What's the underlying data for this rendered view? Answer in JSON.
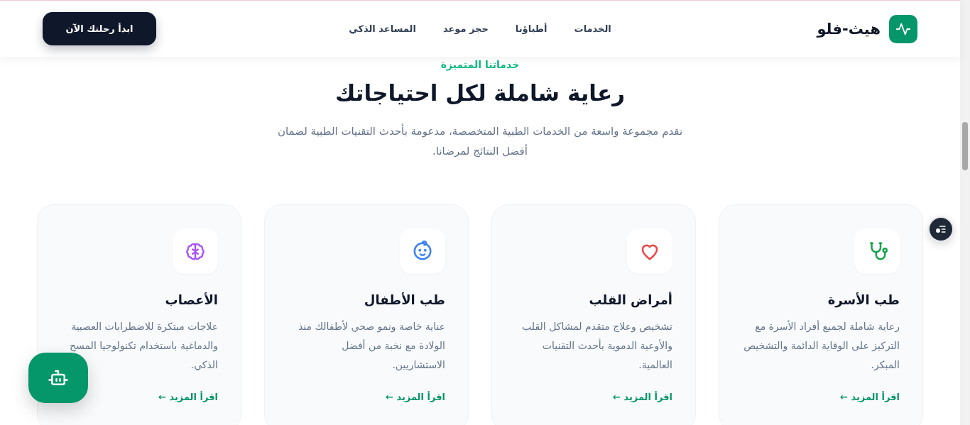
{
  "header": {
    "logo": "هيث-فلو",
    "nav": [
      {
        "label": "الخدمات"
      },
      {
        "label": "أطباؤنا"
      },
      {
        "label": "حجز موعد"
      },
      {
        "label": "المساعد الذكي"
      }
    ],
    "cta": "ابدأ رحلتك الآن"
  },
  "section": {
    "eyebrow": "خدماتنا المتميزة",
    "title": "رعاية شاملة لكل احتياجاتك",
    "intro": "نقدم مجموعة واسعة من الخدمات الطبية المتخصصة، مدعومة بأحدث التقنيات الطبية لضمان أفضل النتائج لمرضانا."
  },
  "services": [
    {
      "kind": "stethoscope",
      "title": "طب الأسرة",
      "text": "رعاية شاملة لجميع أفراد الأسرة مع التركيز على الوقاية الدائمة والتشخيص المبكر.",
      "link": "اقرأ المزيد ←"
    },
    {
      "kind": "heart",
      "title": "أمراض القلب",
      "text": "تشخيص وعلاج متقدم لمشاكل القلب والأوعية الدموية بأحدث التقنيات العالمية.",
      "link": "اقرأ المزيد ←"
    },
    {
      "kind": "baby",
      "title": "طب الأطفال",
      "text": "عناية خاصة ونمو صحي لأطفالك منذ الولادة مع نخبة من أفضل الاستشاريين.",
      "link": "اقرأ المزيد ←"
    },
    {
      "kind": "brain",
      "title": "الأعصاب",
      "text": "علاجات مبتكرة للاضطرابات العصبية والدماغية باستخدام تكنولوجيا المسح الذكي.",
      "link": "اقرأ المزيد ←"
    }
  ]
}
